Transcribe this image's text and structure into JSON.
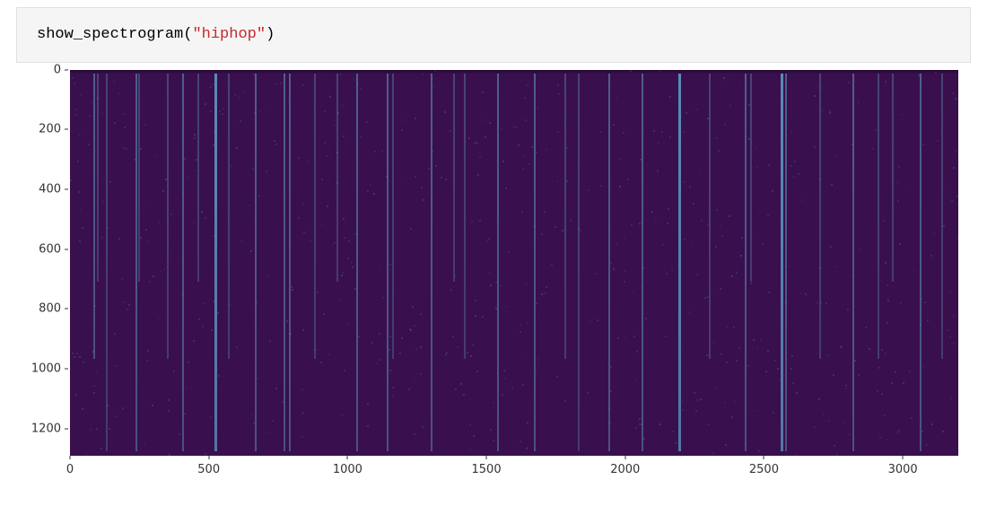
{
  "code": {
    "function_name": "show_spectrogram",
    "open_paren": "(",
    "string_arg": "\"hiphop\"",
    "close_paren": ")"
  },
  "chart_data": {
    "type": "heatmap",
    "title": "",
    "xlabel": "",
    "ylabel": "",
    "xlim": [
      0,
      3200
    ],
    "ylim": [
      0,
      1290
    ],
    "x_ticks": [
      0,
      500,
      1000,
      1500,
      2000,
      2500,
      3000
    ],
    "y_ticks": [
      0,
      200,
      400,
      600,
      800,
      1000,
      1200
    ],
    "note": "spectrogram image (y-axis inverted: 0 at top). vertical_bands are approximate x positions of prominent energy stripes; intensity 0-1",
    "vertical_bands": [
      {
        "x": 85,
        "intensity": 0.55,
        "len": "mid"
      },
      {
        "x": 98,
        "intensity": 0.35,
        "len": "short"
      },
      {
        "x": 130,
        "intensity": 0.5,
        "len": "full"
      },
      {
        "x": 235,
        "intensity": 0.6,
        "len": "full"
      },
      {
        "x": 247,
        "intensity": 0.35,
        "len": "short"
      },
      {
        "x": 350,
        "intensity": 0.4,
        "len": "mid"
      },
      {
        "x": 405,
        "intensity": 0.55,
        "len": "full"
      },
      {
        "x": 460,
        "intensity": 0.35,
        "len": "short"
      },
      {
        "x": 520,
        "intensity": 0.95,
        "len": "full"
      },
      {
        "x": 570,
        "intensity": 0.4,
        "len": "mid"
      },
      {
        "x": 665,
        "intensity": 0.55,
        "len": "full"
      },
      {
        "x": 770,
        "intensity": 0.7,
        "len": "full"
      },
      {
        "x": 790,
        "intensity": 0.6,
        "len": "full"
      },
      {
        "x": 880,
        "intensity": 0.4,
        "len": "mid"
      },
      {
        "x": 960,
        "intensity": 0.35,
        "len": "short"
      },
      {
        "x": 1030,
        "intensity": 0.55,
        "len": "full"
      },
      {
        "x": 1140,
        "intensity": 0.7,
        "len": "full"
      },
      {
        "x": 1160,
        "intensity": 0.5,
        "len": "mid"
      },
      {
        "x": 1300,
        "intensity": 0.55,
        "len": "full"
      },
      {
        "x": 1380,
        "intensity": 0.35,
        "len": "short"
      },
      {
        "x": 1420,
        "intensity": 0.4,
        "len": "mid"
      },
      {
        "x": 1540,
        "intensity": 0.55,
        "len": "full"
      },
      {
        "x": 1670,
        "intensity": 0.6,
        "len": "full"
      },
      {
        "x": 1780,
        "intensity": 0.5,
        "len": "mid"
      },
      {
        "x": 1830,
        "intensity": 0.4,
        "len": "full"
      },
      {
        "x": 1940,
        "intensity": 0.55,
        "len": "full"
      },
      {
        "x": 2060,
        "intensity": 0.55,
        "len": "full"
      },
      {
        "x": 2190,
        "intensity": 0.9,
        "len": "full"
      },
      {
        "x": 2300,
        "intensity": 0.45,
        "len": "mid"
      },
      {
        "x": 2430,
        "intensity": 0.55,
        "len": "full"
      },
      {
        "x": 2450,
        "intensity": 0.35,
        "len": "short"
      },
      {
        "x": 2560,
        "intensity": 0.95,
        "len": "full"
      },
      {
        "x": 2575,
        "intensity": 0.6,
        "len": "full"
      },
      {
        "x": 2700,
        "intensity": 0.5,
        "len": "mid"
      },
      {
        "x": 2820,
        "intensity": 0.55,
        "len": "full"
      },
      {
        "x": 2910,
        "intensity": 0.45,
        "len": "mid"
      },
      {
        "x": 2960,
        "intensity": 0.35,
        "len": "short"
      },
      {
        "x": 3060,
        "intensity": 0.55,
        "len": "full"
      },
      {
        "x": 3140,
        "intensity": 0.4,
        "len": "mid"
      }
    ]
  }
}
